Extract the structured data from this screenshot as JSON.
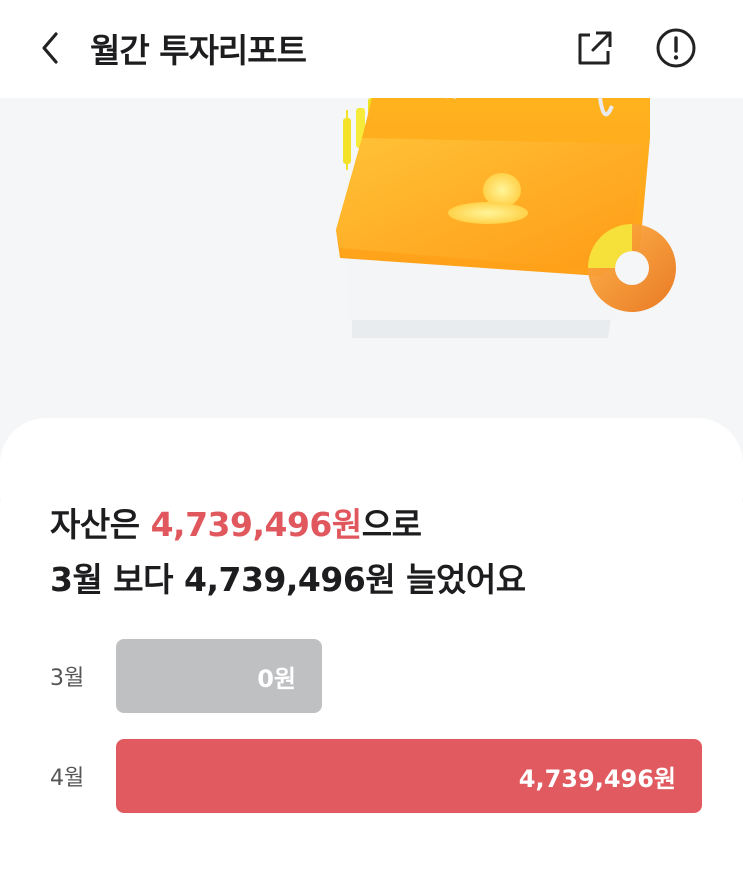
{
  "header": {
    "title": "월간 투자리포트",
    "icons": {
      "back": "chevron-left-icon",
      "share": "share-external-icon",
      "info": "info-circle-icon"
    }
  },
  "hero": {
    "illustration": "calendar-with-donut-chart-illustration"
  },
  "summary": {
    "line1_prefix": "자산은 ",
    "line1_amount": "4,739,496원",
    "line1_suffix": "으로",
    "line2": "3월 보다 4,739,496원 늘었어요"
  },
  "comparison": [
    {
      "label": "3월",
      "value_text": "0원",
      "value": 0,
      "color": "#bfc0c2"
    },
    {
      "label": "4월",
      "value_text": "4,739,496원",
      "value": 4739496,
      "color": "#e05a60"
    }
  ],
  "colors": {
    "accent": "#e0575e",
    "hero_bg": "#f4f6f8"
  }
}
